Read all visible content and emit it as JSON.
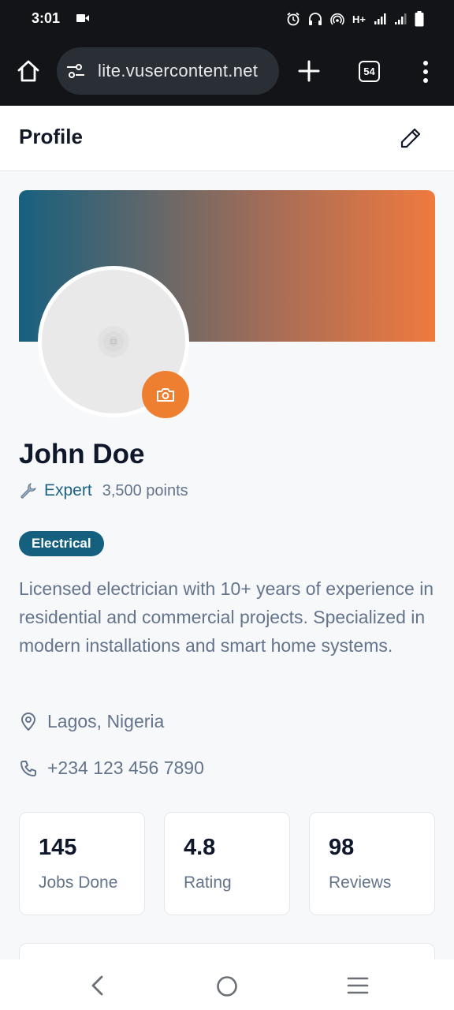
{
  "status_bar": {
    "time": "3:01",
    "network": "H+"
  },
  "browser": {
    "url": "lite.vusercontent.net",
    "tab_count": "54"
  },
  "header": {
    "title": "Profile"
  },
  "profile": {
    "name": "John Doe",
    "level": "Expert",
    "points": "3,500 points",
    "category": "Electrical",
    "bio": "Licensed electrician with 10+ years of experience in residential and commercial projects. Specialized in modern installations and smart home systems.",
    "location": "Lagos, Nigeria",
    "phone": "+234 123 456 7890"
  },
  "stats": [
    {
      "value": "145",
      "label": "Jobs Done"
    },
    {
      "value": "4.8",
      "label": "Rating"
    },
    {
      "value": "98",
      "label": "Reviews"
    }
  ],
  "colors": {
    "primary": "#16607f",
    "accent": "#ee7f30",
    "muted_text": "#64748b"
  }
}
